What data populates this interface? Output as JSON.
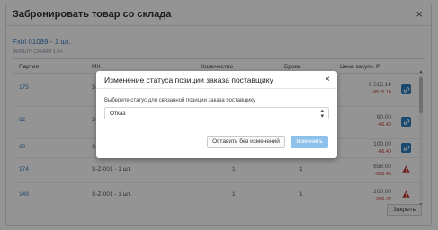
{
  "modal": {
    "title": "Забронировать товар со склада",
    "close_glyph": "×",
    "product": {
      "link": "Fxbl 01089",
      "qty": " - 1 шт.",
      "subtitle": "ФИЛЬТР СИНИЙ 1.5л"
    },
    "table": {
      "headers": {
        "party": "Партия",
        "mh": "МХ",
        "quantity": "Количество",
        "reserve": "Бронь",
        "price": "Цена закупк. Р"
      },
      "rows": [
        {
          "party": "175",
          "mh": "S-Z-001",
          "qty": "",
          "reserve": "",
          "price_main": "9 515.14",
          "price_sub": "-9515.14",
          "action": "edit-icon"
        },
        {
          "party": "62",
          "mh": "S-Z-001",
          "qty": "",
          "reserve": "",
          "price_main": "60.00",
          "price_sub": "-66.40",
          "action": "edit-icon"
        },
        {
          "party": "60",
          "mh": "S-Z-001",
          "qty": "",
          "reserve": "",
          "price_main": "100.00",
          "price_sub": "-86.40",
          "action": "edit-icon"
        },
        {
          "party": "174",
          "mh": "S-Z-001 - 1 шт.",
          "qty": "1",
          "reserve": "1",
          "price_main": "658.00",
          "price_sub": "-658.45",
          "action": "warning-icon"
        },
        {
          "party": "149",
          "mh": "S-Z-001 - 1 шт.",
          "qty": "1",
          "reserve": "1",
          "price_main": "200.00",
          "price_sub": "-206.47",
          "action": "warning-icon"
        }
      ]
    },
    "close_button": "Закрыть"
  },
  "dialog": {
    "title": "Изменение статуса позиции заказа поставщику",
    "close_glyph": "×",
    "label": "Выберите статус для связанной позиции заказа поставщику",
    "select_value": "Отказ",
    "select_arrow": "▴▾",
    "keep_button": "Оставить без изменений",
    "change_button": "Изменить"
  },
  "colors": {
    "link": "#3a7dbf",
    "edit_button": "#2d7fc1",
    "warning": "#c0392b",
    "primary_disabled": "#8ec1ea",
    "overlay": "rgba(0,0,0,0.42)"
  }
}
